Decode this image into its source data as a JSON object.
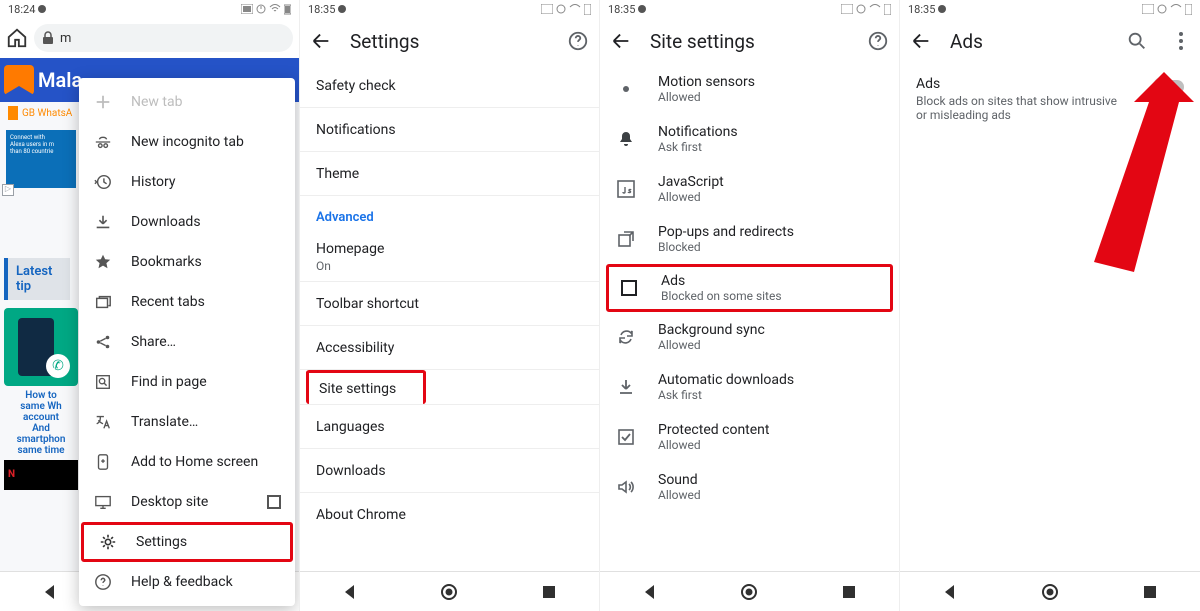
{
  "panel1": {
    "status_time": "18:24",
    "url_text": "m",
    "banner_text": "Mala",
    "gb_text": "GB WhatsA",
    "ad_lines": [
      "Connect with",
      "Alexa users in m",
      "than 80 countrie"
    ],
    "latest_label": "Latest tip",
    "card_caption": "How to\nsame Wh\naccount\nAnd\nsmartphon\nsame time",
    "menu": {
      "new_tab": "New tab",
      "incognito": "New incognito tab",
      "history": "History",
      "downloads": "Downloads",
      "bookmarks": "Bookmarks",
      "recent_tabs": "Recent tabs",
      "share": "Share…",
      "find": "Find in page",
      "translate": "Translate…",
      "a2hs": "Add to Home screen",
      "desktop": "Desktop site",
      "settings": "Settings",
      "help": "Help & feedback"
    }
  },
  "panel2": {
    "status_time": "18:35",
    "title": "Settings",
    "rows": {
      "safety": "Safety check",
      "notifications": "Notifications",
      "theme": "Theme",
      "advanced": "Advanced",
      "homepage": "Homepage",
      "homepage_sub": "On",
      "toolbar": "Toolbar shortcut",
      "accessibility": "Accessibility",
      "site_settings": "Site settings",
      "languages": "Languages",
      "downloads": "Downloads",
      "about": "About Chrome"
    }
  },
  "panel3": {
    "status_time": "18:35",
    "title": "Site settings",
    "rows": [
      {
        "icon": "motion",
        "label": "Motion sensors",
        "sub": "Allowed"
      },
      {
        "icon": "bell",
        "label": "Notifications",
        "sub": "Ask first"
      },
      {
        "icon": "js",
        "label": "JavaScript",
        "sub": "Allowed"
      },
      {
        "icon": "popup",
        "label": "Pop-ups and redirects",
        "sub": "Blocked"
      },
      {
        "icon": "ads",
        "label": "Ads",
        "sub": "Blocked on some sites"
      },
      {
        "icon": "sync",
        "label": "Background sync",
        "sub": "Allowed"
      },
      {
        "icon": "download",
        "label": "Automatic downloads",
        "sub": "Ask first"
      },
      {
        "icon": "protect",
        "label": "Protected content",
        "sub": "Allowed"
      },
      {
        "icon": "sound",
        "label": "Sound",
        "sub": "Allowed"
      }
    ]
  },
  "panel4": {
    "status_time": "18:35",
    "title": "Ads",
    "ads_title": "Ads",
    "ads_desc": "Block ads on sites that show intrusive or misleading ads"
  }
}
